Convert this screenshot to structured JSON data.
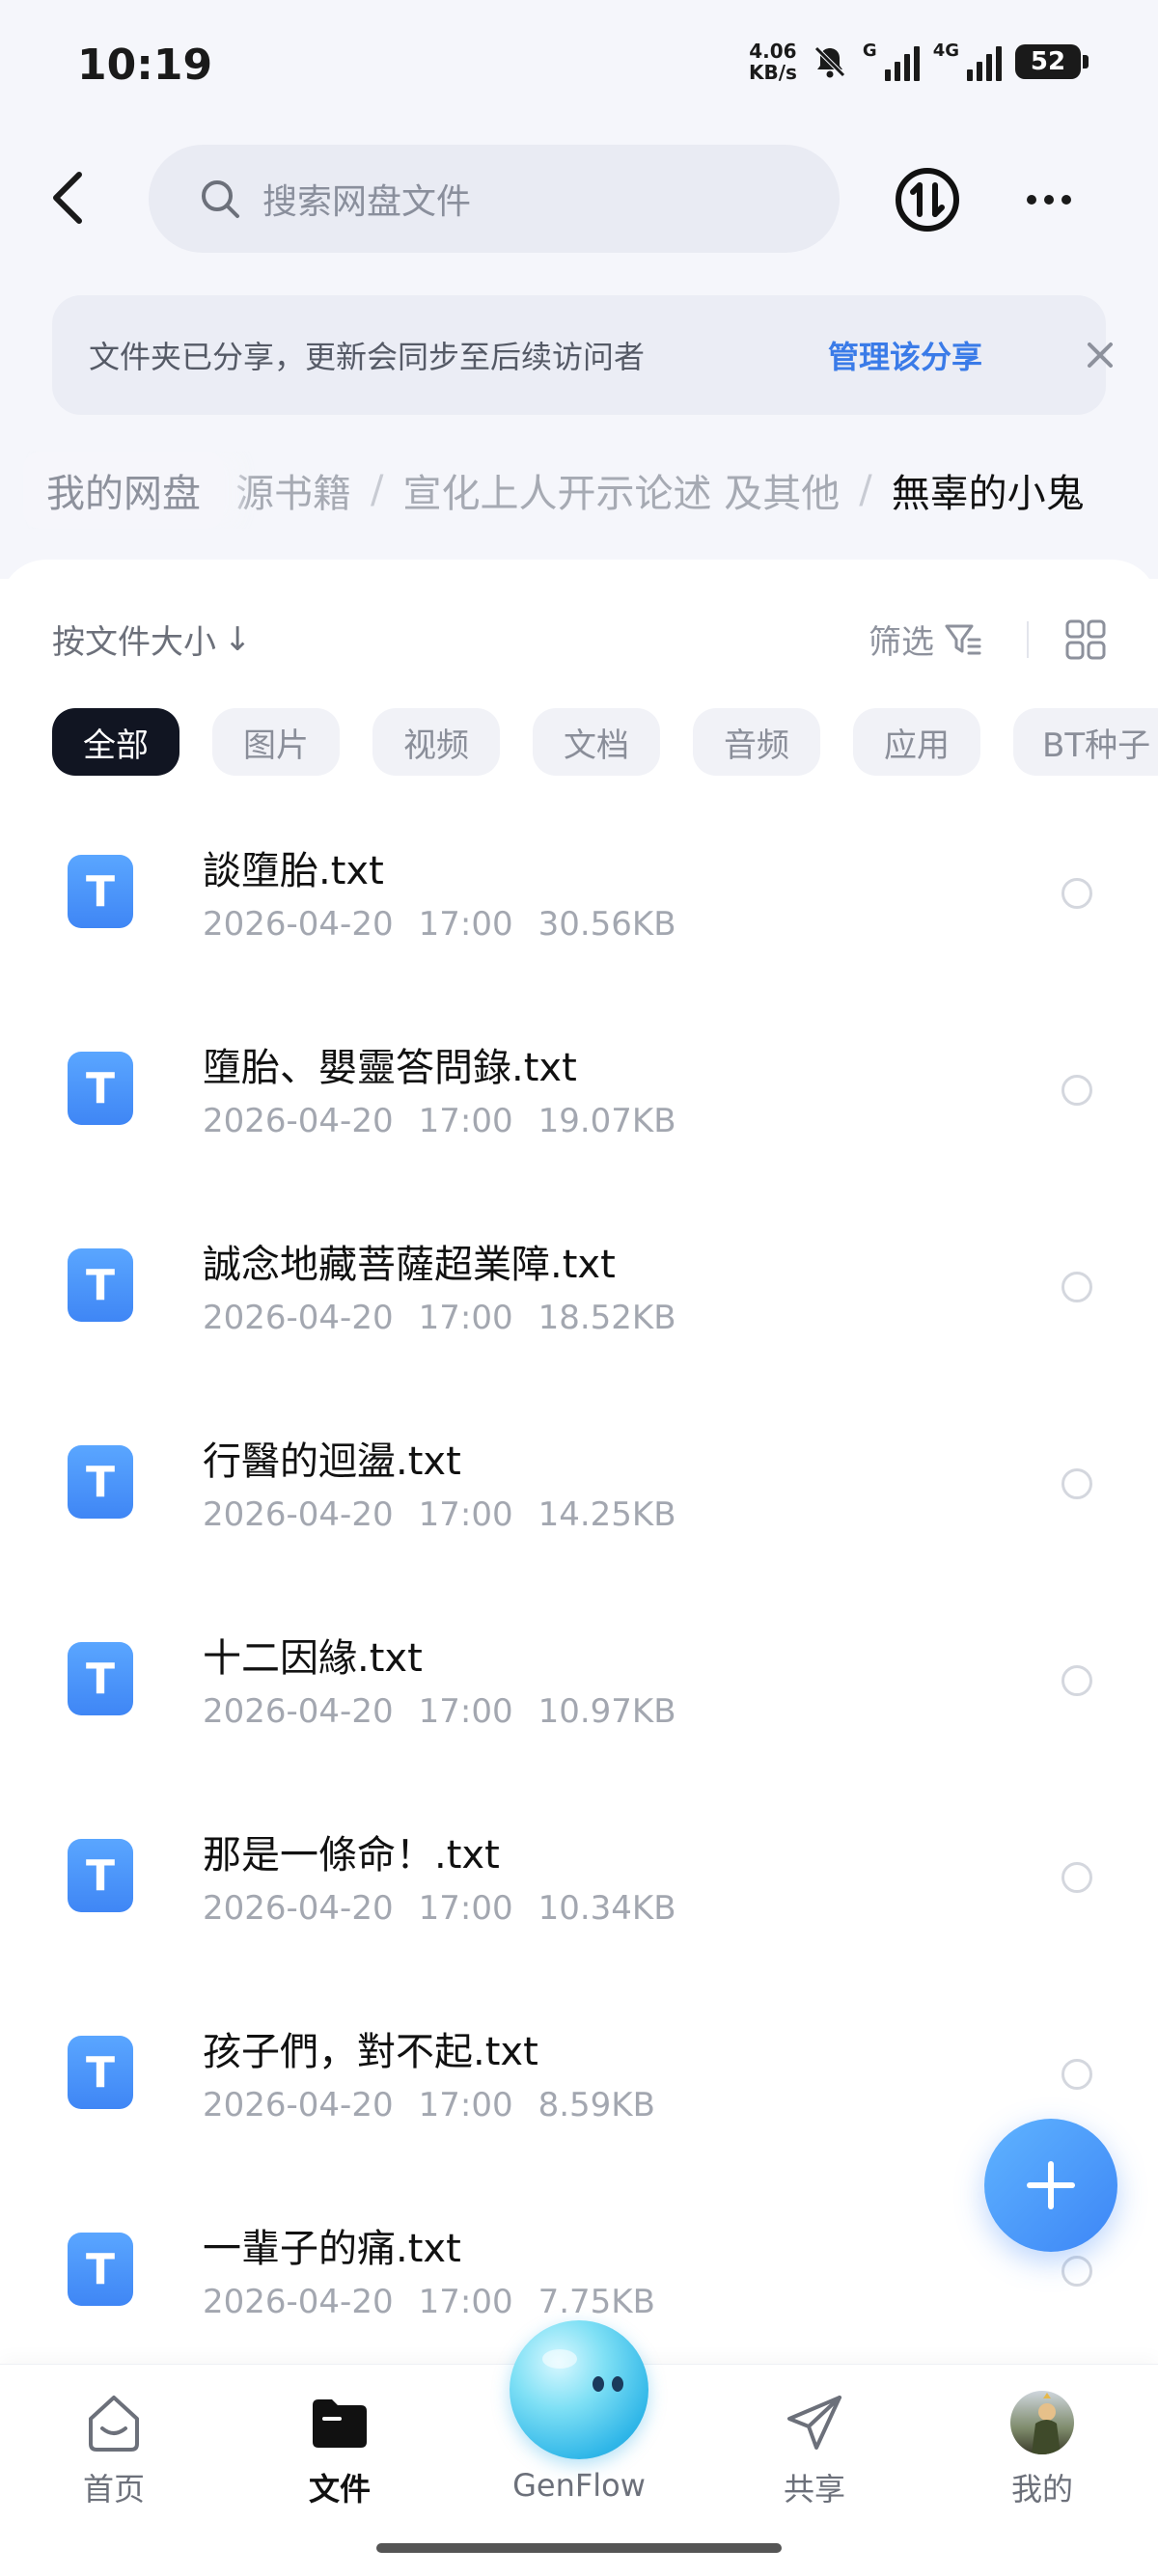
{
  "status_bar": {
    "time": "10:19",
    "net_speed_value": "4.06",
    "net_speed_unit": "KB/s",
    "sim1_label": "G",
    "sim2_label": "4G",
    "battery": "52"
  },
  "header": {
    "search_placeholder": "搜索网盘文件"
  },
  "share_banner": {
    "text": "文件夹已分享，更新会同步至后续访问者",
    "manage_label": "管理该分享"
  },
  "breadcrumb": {
    "home": "我的网盘",
    "items": [
      "源书籍",
      "宣化上人开示论述 及其他"
    ],
    "current": "無辜的小鬼",
    "separator": "/"
  },
  "toolbar": {
    "sort_label": "按文件大小",
    "sort_arrow": "↓",
    "filter_label": "筛选"
  },
  "chips": [
    {
      "label": "全部",
      "active": true
    },
    {
      "label": "图片",
      "active": false
    },
    {
      "label": "视频",
      "active": false
    },
    {
      "label": "文档",
      "active": false
    },
    {
      "label": "音频",
      "active": false
    },
    {
      "label": "应用",
      "active": false
    },
    {
      "label": "BT种子",
      "active": false
    }
  ],
  "files": [
    {
      "name": "談墮胎.txt",
      "date": "2026-04-20",
      "time": "17:00",
      "size": "30.56KB",
      "icon_letter": "T"
    },
    {
      "name": "墮胎、嬰靈答問錄.txt",
      "date": "2026-04-20",
      "time": "17:00",
      "size": "19.07KB",
      "icon_letter": "T"
    },
    {
      "name": "誠念地藏菩薩超業障.txt",
      "date": "2026-04-20",
      "time": "17:00",
      "size": "18.52KB",
      "icon_letter": "T"
    },
    {
      "name": "行醫的迴盪.txt",
      "date": "2026-04-20",
      "time": "17:00",
      "size": "14.25KB",
      "icon_letter": "T"
    },
    {
      "name": "十二因緣.txt",
      "date": "2026-04-20",
      "time": "17:00",
      "size": "10.97KB",
      "icon_letter": "T"
    },
    {
      "name": "那是一條命！.txt",
      "date": "2026-04-20",
      "time": "17:00",
      "size": "10.34KB",
      "icon_letter": "T"
    },
    {
      "name": "孩子們，對不起.txt",
      "date": "2026-04-20",
      "time": "17:00",
      "size": "8.59KB",
      "icon_letter": "T"
    },
    {
      "name": "一輩子的痛.txt",
      "date": "2026-04-20",
      "time": "17:00",
      "size": "7.75KB",
      "icon_letter": "T"
    }
  ],
  "bottom_nav": {
    "home": "首页",
    "files": "文件",
    "genflow": "GenFlow",
    "share": "共享",
    "mine": "我的"
  },
  "colors": {
    "accent": "#3a7be8",
    "file_icon": "#4a90f7",
    "chip_active_bg": "#111522",
    "page_bg": "#f5f6fb"
  }
}
